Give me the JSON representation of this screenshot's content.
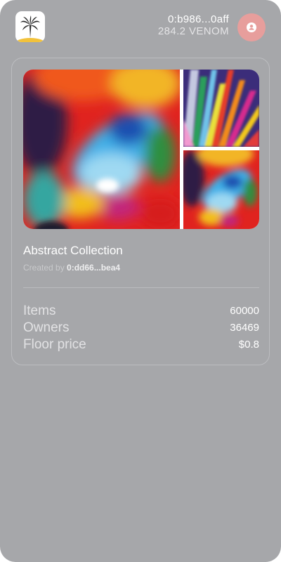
{
  "header": {
    "account_address": "0:b986...0aff",
    "balance": "284.2 VENOM",
    "logo_icon": "palm-island-icon",
    "avatar_icon": "user-icon",
    "avatar_color": "#e79e9c"
  },
  "collection": {
    "title": "Abstract Collection",
    "created_by_label": "Created by",
    "creator_address": "0:dd66...bea4",
    "images": [
      "abstract-ink-artwork",
      "abstract-feathers-artwork",
      "abstract-ink-artwork-thumb"
    ],
    "stats": [
      {
        "label": "Items",
        "value": "60000"
      },
      {
        "label": "Owners",
        "value": "36469"
      },
      {
        "label": "Floor price",
        "value": "$0.8"
      }
    ]
  },
  "colors": {
    "background": "#a6a7aa",
    "card_border": "#bcbdc0",
    "text_primary": "#ffffff"
  }
}
